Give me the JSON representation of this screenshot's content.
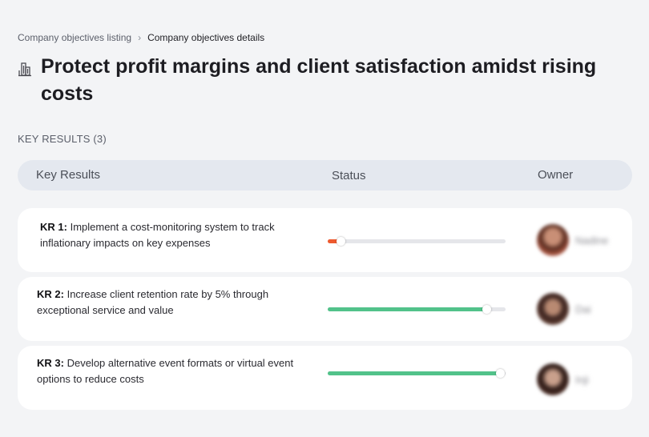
{
  "breadcrumb": {
    "listing": "Company objectives listing",
    "separator": "›",
    "current": "Company objectives details"
  },
  "objective": {
    "icon": "office-building-icon",
    "title": "Protect profit margins and client satisfaction amidst rising costs"
  },
  "key_results_section": {
    "label": "KEY RESULTS (3)"
  },
  "table": {
    "columns": {
      "key_results": "Key Results",
      "status": "Status",
      "owner": "Owner"
    },
    "rows": [
      {
        "id": "KR 1:",
        "text": "Implement a cost-monitoring system to track inflationary impacts on key expenses",
        "progress": 0.07,
        "progress_color": "#ee5a2f",
        "owner": "Nadine"
      },
      {
        "id": "KR 2:",
        "text": "Increase client retention rate by 5% through exceptional service and value",
        "progress": 0.89,
        "progress_color": "#52c28a",
        "owner": "Dai"
      },
      {
        "id": "KR 3:",
        "text": "Develop alternative event formats or virtual event options to reduce costs",
        "progress": 0.97,
        "progress_color": "#52c28a",
        "owner": "Inji"
      }
    ]
  }
}
